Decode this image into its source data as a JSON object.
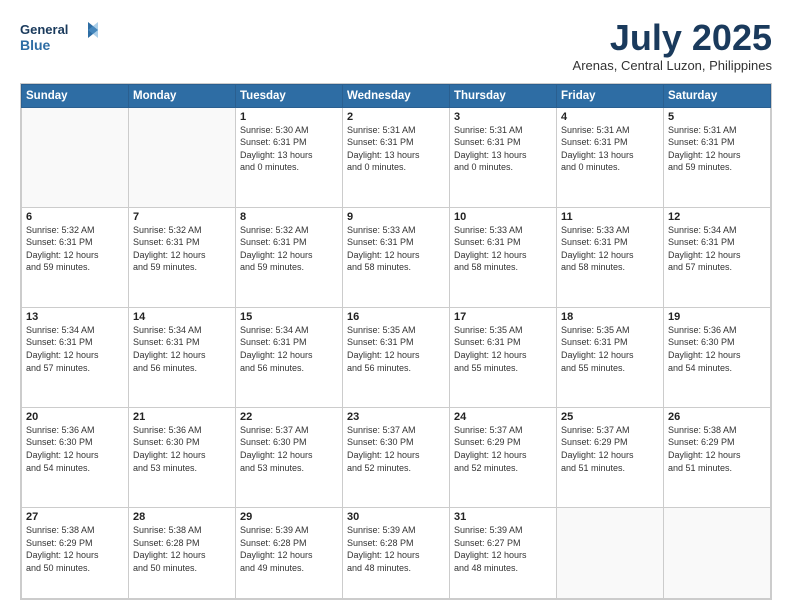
{
  "logo": {
    "line1": "General",
    "line2": "Blue"
  },
  "title": "July 2025",
  "subtitle": "Arenas, Central Luzon, Philippines",
  "days_of_week": [
    "Sunday",
    "Monday",
    "Tuesday",
    "Wednesday",
    "Thursday",
    "Friday",
    "Saturday"
  ],
  "weeks": [
    [
      {
        "day": "",
        "info": ""
      },
      {
        "day": "",
        "info": ""
      },
      {
        "day": "1",
        "info": "Sunrise: 5:30 AM\nSunset: 6:31 PM\nDaylight: 13 hours\nand 0 minutes."
      },
      {
        "day": "2",
        "info": "Sunrise: 5:31 AM\nSunset: 6:31 PM\nDaylight: 13 hours\nand 0 minutes."
      },
      {
        "day": "3",
        "info": "Sunrise: 5:31 AM\nSunset: 6:31 PM\nDaylight: 13 hours\nand 0 minutes."
      },
      {
        "day": "4",
        "info": "Sunrise: 5:31 AM\nSunset: 6:31 PM\nDaylight: 13 hours\nand 0 minutes."
      },
      {
        "day": "5",
        "info": "Sunrise: 5:31 AM\nSunset: 6:31 PM\nDaylight: 12 hours\nand 59 minutes."
      }
    ],
    [
      {
        "day": "6",
        "info": "Sunrise: 5:32 AM\nSunset: 6:31 PM\nDaylight: 12 hours\nand 59 minutes."
      },
      {
        "day": "7",
        "info": "Sunrise: 5:32 AM\nSunset: 6:31 PM\nDaylight: 12 hours\nand 59 minutes."
      },
      {
        "day": "8",
        "info": "Sunrise: 5:32 AM\nSunset: 6:31 PM\nDaylight: 12 hours\nand 59 minutes."
      },
      {
        "day": "9",
        "info": "Sunrise: 5:33 AM\nSunset: 6:31 PM\nDaylight: 12 hours\nand 58 minutes."
      },
      {
        "day": "10",
        "info": "Sunrise: 5:33 AM\nSunset: 6:31 PM\nDaylight: 12 hours\nand 58 minutes."
      },
      {
        "day": "11",
        "info": "Sunrise: 5:33 AM\nSunset: 6:31 PM\nDaylight: 12 hours\nand 58 minutes."
      },
      {
        "day": "12",
        "info": "Sunrise: 5:34 AM\nSunset: 6:31 PM\nDaylight: 12 hours\nand 57 minutes."
      }
    ],
    [
      {
        "day": "13",
        "info": "Sunrise: 5:34 AM\nSunset: 6:31 PM\nDaylight: 12 hours\nand 57 minutes."
      },
      {
        "day": "14",
        "info": "Sunrise: 5:34 AM\nSunset: 6:31 PM\nDaylight: 12 hours\nand 56 minutes."
      },
      {
        "day": "15",
        "info": "Sunrise: 5:34 AM\nSunset: 6:31 PM\nDaylight: 12 hours\nand 56 minutes."
      },
      {
        "day": "16",
        "info": "Sunrise: 5:35 AM\nSunset: 6:31 PM\nDaylight: 12 hours\nand 56 minutes."
      },
      {
        "day": "17",
        "info": "Sunrise: 5:35 AM\nSunset: 6:31 PM\nDaylight: 12 hours\nand 55 minutes."
      },
      {
        "day": "18",
        "info": "Sunrise: 5:35 AM\nSunset: 6:31 PM\nDaylight: 12 hours\nand 55 minutes."
      },
      {
        "day": "19",
        "info": "Sunrise: 5:36 AM\nSunset: 6:30 PM\nDaylight: 12 hours\nand 54 minutes."
      }
    ],
    [
      {
        "day": "20",
        "info": "Sunrise: 5:36 AM\nSunset: 6:30 PM\nDaylight: 12 hours\nand 54 minutes."
      },
      {
        "day": "21",
        "info": "Sunrise: 5:36 AM\nSunset: 6:30 PM\nDaylight: 12 hours\nand 53 minutes."
      },
      {
        "day": "22",
        "info": "Sunrise: 5:37 AM\nSunset: 6:30 PM\nDaylight: 12 hours\nand 53 minutes."
      },
      {
        "day": "23",
        "info": "Sunrise: 5:37 AM\nSunset: 6:30 PM\nDaylight: 12 hours\nand 52 minutes."
      },
      {
        "day": "24",
        "info": "Sunrise: 5:37 AM\nSunset: 6:29 PM\nDaylight: 12 hours\nand 52 minutes."
      },
      {
        "day": "25",
        "info": "Sunrise: 5:37 AM\nSunset: 6:29 PM\nDaylight: 12 hours\nand 51 minutes."
      },
      {
        "day": "26",
        "info": "Sunrise: 5:38 AM\nSunset: 6:29 PM\nDaylight: 12 hours\nand 51 minutes."
      }
    ],
    [
      {
        "day": "27",
        "info": "Sunrise: 5:38 AM\nSunset: 6:29 PM\nDaylight: 12 hours\nand 50 minutes."
      },
      {
        "day": "28",
        "info": "Sunrise: 5:38 AM\nSunset: 6:28 PM\nDaylight: 12 hours\nand 50 minutes."
      },
      {
        "day": "29",
        "info": "Sunrise: 5:39 AM\nSunset: 6:28 PM\nDaylight: 12 hours\nand 49 minutes."
      },
      {
        "day": "30",
        "info": "Sunrise: 5:39 AM\nSunset: 6:28 PM\nDaylight: 12 hours\nand 48 minutes."
      },
      {
        "day": "31",
        "info": "Sunrise: 5:39 AM\nSunset: 6:27 PM\nDaylight: 12 hours\nand 48 minutes."
      },
      {
        "day": "",
        "info": ""
      },
      {
        "day": "",
        "info": ""
      }
    ]
  ]
}
